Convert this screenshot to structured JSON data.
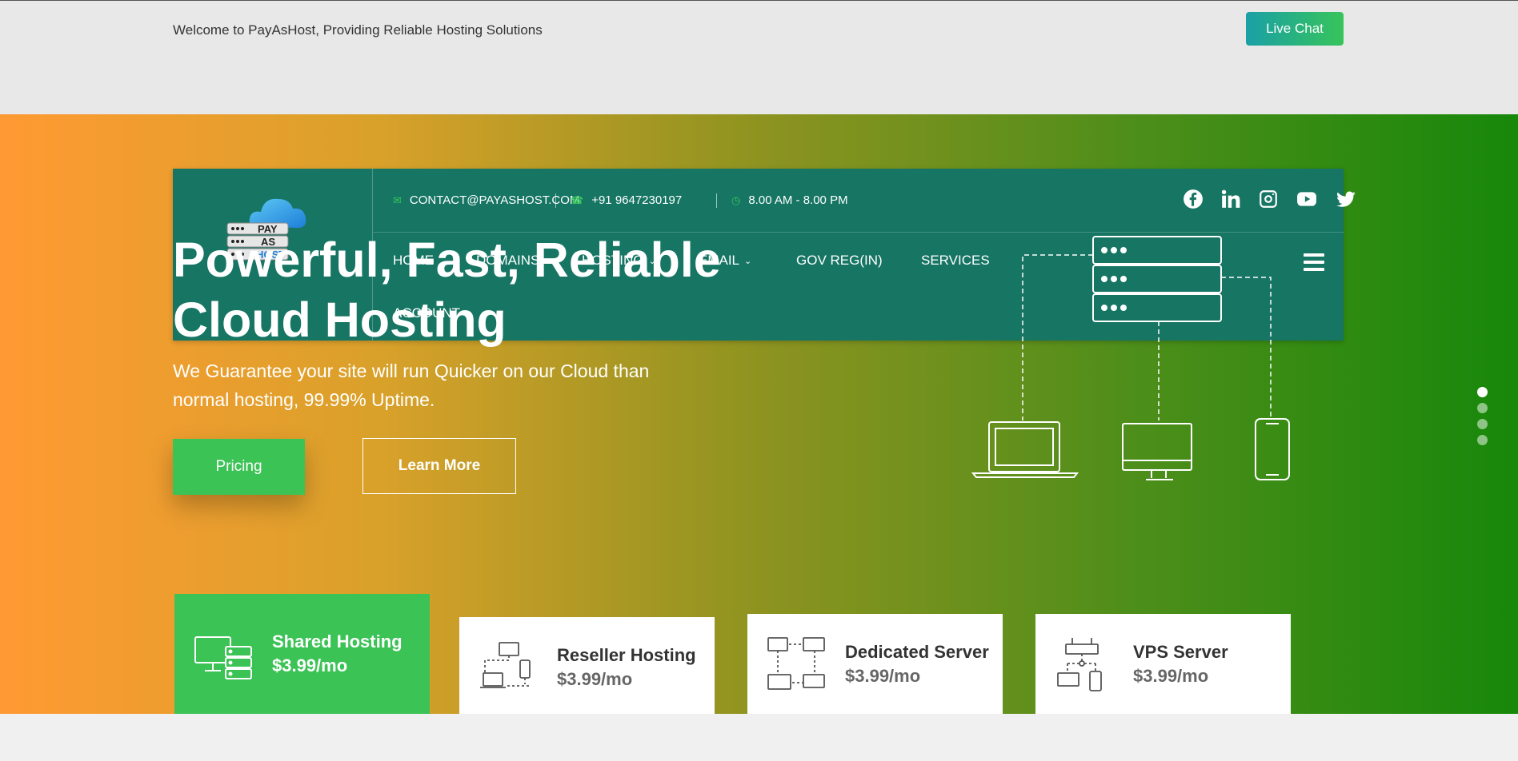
{
  "topbar": {
    "welcome": "Welcome to PayAsHost, Providing Reliable Hosting Solutions",
    "live_chat": "Live Chat"
  },
  "logo": {
    "line1": "PAY",
    "line2": "AS",
    "line3": "HOST"
  },
  "contact": {
    "email": "CONTACT@PAYASHOST.COM",
    "phone": "+91 9647230197",
    "hours": "8.00 AM - 8.00 PM"
  },
  "social": [
    "facebook-icon",
    "linkedin-icon",
    "instagram-icon",
    "youtube-icon",
    "twitter-icon"
  ],
  "nav": {
    "home": "HOME",
    "domains": "DOMAINS",
    "hosting": "HOSTING",
    "email": "EMAIL",
    "gov": "GOV REG(IN)",
    "services": "SERVICES",
    "account": "ACCOUNT"
  },
  "hero": {
    "headline_1": "Powerful, Fast, Reliable",
    "headline_2": "Cloud Hosting",
    "sub_1": "We Guarantee your site will run Quicker on our Cloud than",
    "sub_2": "normal hosting, 99.99% Uptime.",
    "pricing": "Pricing",
    "learn_more": "Learn More"
  },
  "slider": {
    "count": 4,
    "active": 1
  },
  "plans": [
    {
      "title": "Shared Hosting",
      "price": "$3.99/mo"
    },
    {
      "title": "Reseller Hosting",
      "price": "$3.99/mo"
    },
    {
      "title": "Dedicated Server",
      "price": "$3.99/mo"
    },
    {
      "title": "VPS Server",
      "price": "$3.99/mo"
    }
  ],
  "colors": {
    "header": "#167563",
    "accent_green": "#3cc356",
    "gradient_start": "#ff9a33",
    "gradient_end": "#17880a"
  }
}
